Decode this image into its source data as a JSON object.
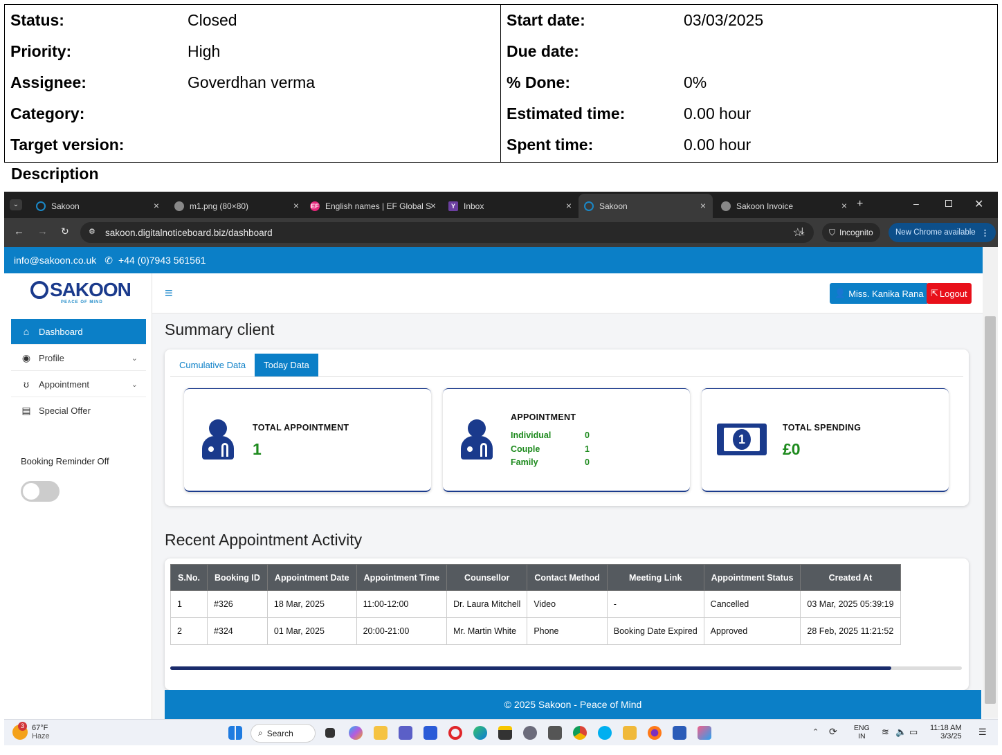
{
  "issue": {
    "left": [
      {
        "label": "Status:",
        "value": "Closed"
      },
      {
        "label": "Priority:",
        "value": "High"
      },
      {
        "label": "Assignee:",
        "value": "Goverdhan verma"
      },
      {
        "label": "Category:",
        "value": ""
      },
      {
        "label": "Target version:",
        "value": ""
      }
    ],
    "right": [
      {
        "label": "Start date:",
        "value": "03/03/2025"
      },
      {
        "label": "Due date:",
        "value": ""
      },
      {
        "label": "% Done:",
        "value": "0%"
      },
      {
        "label": "Estimated time:",
        "value": "0.00 hour"
      },
      {
        "label": "Spent time:",
        "value": "0.00 hour"
      }
    ],
    "description_title": "Description"
  },
  "browser": {
    "tabs": [
      {
        "title": "Sakoon",
        "icon": "sakoon-icon"
      },
      {
        "title": "m1.png (80×80)",
        "icon": "globe-icon"
      },
      {
        "title": "English names | EF Global S",
        "icon": "ef-icon"
      },
      {
        "title": "Inbox",
        "icon": "mail-icon"
      },
      {
        "title": "Sakoon",
        "icon": "sakoon-icon",
        "active": true
      },
      {
        "title": "Sakoon Invoice",
        "icon": "globe-icon"
      }
    ],
    "url": "sakoon.digitalnoticeboard.biz/dashboard",
    "incognito_label": "Incognito",
    "update_label": "New Chrome available"
  },
  "site": {
    "email": "info@sakoon.co.uk",
    "phone": "+44 (0)7943 561561",
    "logo": "SAKOON",
    "logo_tagline": "PEACE OF MIND",
    "user_button": "Miss. Kanika Rana",
    "logout_button": "Logout",
    "nav": [
      {
        "label": "Dashboard",
        "icon": "home-icon",
        "active": true
      },
      {
        "label": "Profile",
        "icon": "user-circle-icon"
      },
      {
        "label": "Appointment",
        "icon": "stethoscope-icon"
      },
      {
        "label": "Special Offer",
        "icon": "document-icon"
      }
    ],
    "booking_reminder": "Booking Reminder Off",
    "summary_title": "Summary client",
    "tabs": [
      "Cumulative Data",
      "Today Data"
    ],
    "stats": {
      "total_appointment_label": "TOTAL APPOINTMENT",
      "total_appointment_value": "1",
      "appointment_label": "APPOINTMENT",
      "appointment_breakdown": [
        {
          "name": "Individual",
          "count": "0"
        },
        {
          "name": "Couple",
          "count": "1"
        },
        {
          "name": "Family",
          "count": "0"
        }
      ],
      "total_spending_label": "TOTAL SPENDING",
      "total_spending_value": "£0"
    },
    "recent_title": "Recent Appointment Activity",
    "table": {
      "headers": [
        "S.No.",
        "Booking ID",
        "Appointment Date",
        "Appointment Time",
        "Counsellor",
        "Contact Method",
        "Meeting Link",
        "Appointment Status",
        "Created At"
      ],
      "rows": [
        [
          "1",
          "#326",
          "18 Mar, 2025",
          "11:00-12:00",
          "Dr. Laura Mitchell",
          "Video",
          "-",
          "Cancelled",
          "03 Mar, 2025 05:39:19"
        ],
        [
          "2",
          "#324",
          "01 Mar, 2025",
          "20:00-21:00",
          "Mr. Martin White",
          "Phone",
          "Booking Date Expired",
          "Approved",
          "28 Feb, 2025 11:21:52"
        ]
      ]
    },
    "footer": "© 2025 Sakoon - Peace of Mind"
  },
  "taskbar": {
    "weather_temp": "67°F",
    "weather_desc": "Haze",
    "weather_badge": "3",
    "search_label": "Search",
    "lang_top": "ENG",
    "lang_bottom": "IN",
    "time": "11:18 AM",
    "date": "3/3/25"
  }
}
